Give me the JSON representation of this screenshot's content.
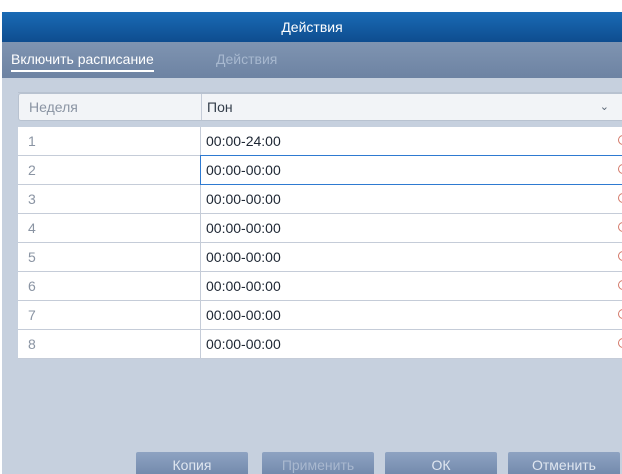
{
  "dialog": {
    "title": "Действия"
  },
  "tabs": [
    {
      "label": "Включить расписание",
      "active": true
    },
    {
      "label": "Действия",
      "active": false
    }
  ],
  "schedule": {
    "day_label": "Неделя",
    "day_value": "Пон",
    "rows": [
      {
        "index": "1",
        "time": "00:00-24:00"
      },
      {
        "index": "2",
        "time": "00:00-00:00"
      },
      {
        "index": "3",
        "time": "00:00-00:00"
      },
      {
        "index": "4",
        "time": "00:00-00:00"
      },
      {
        "index": "5",
        "time": "00:00-00:00"
      },
      {
        "index": "6",
        "time": "00:00-00:00"
      },
      {
        "index": "7",
        "time": "00:00-00:00"
      },
      {
        "index": "8",
        "time": "00:00-00:00"
      }
    ]
  },
  "buttons": {
    "copy": "Копия",
    "apply": "Применить",
    "ok": "ОК",
    "cancel": "Отменить"
  },
  "colors": {
    "title_bar": "#0e4d8f",
    "tab_bar": "#7f94b1",
    "panel_background": "#c6d0de",
    "focus_border": "#2e7ad1"
  }
}
